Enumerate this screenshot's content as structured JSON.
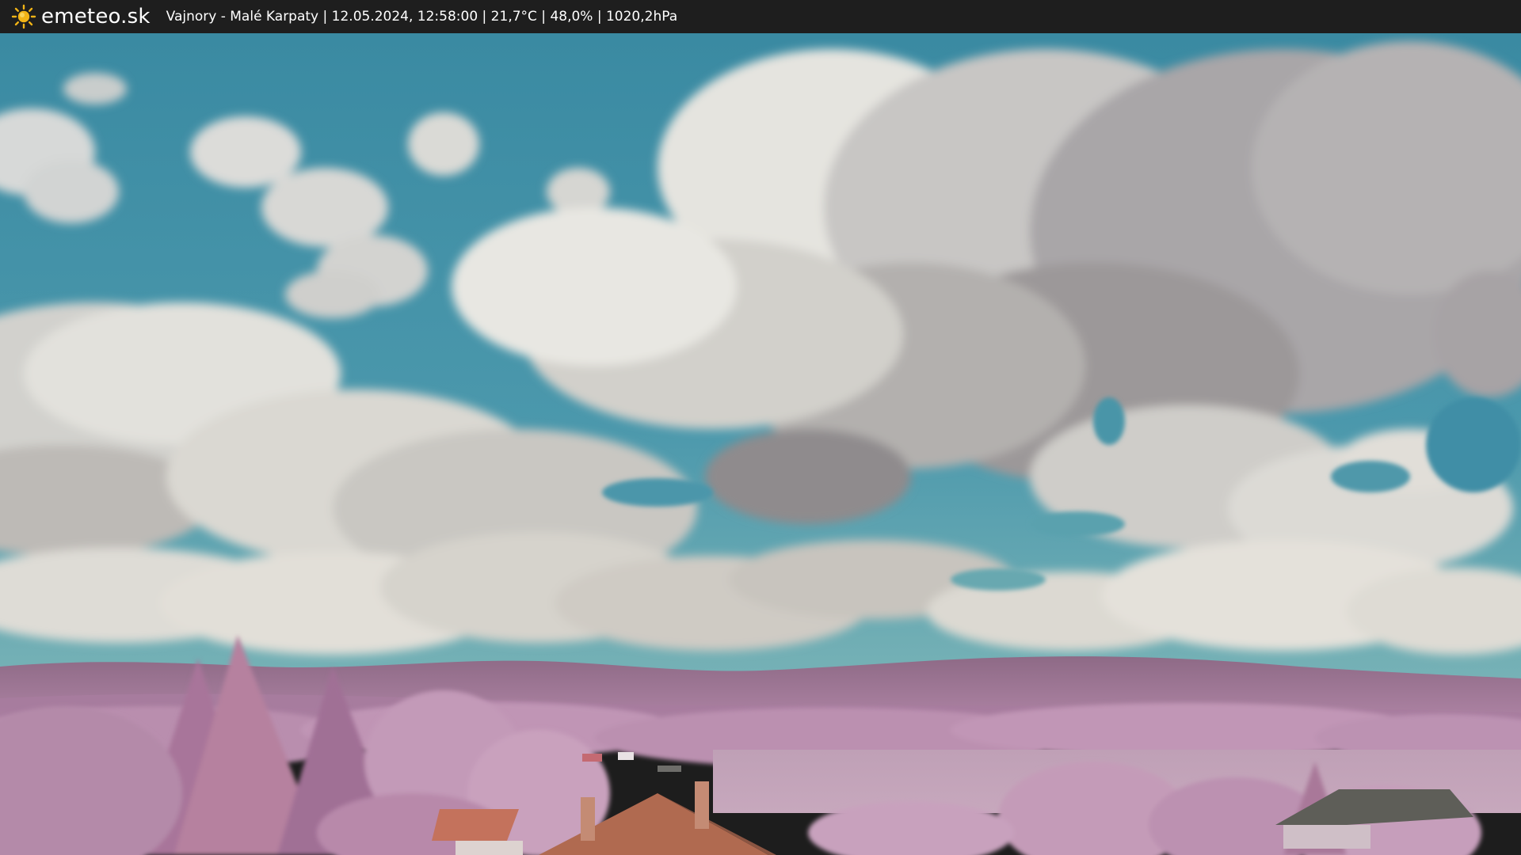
{
  "header": {
    "brand": "emeteo.sk",
    "caption": "Vajnory - Malé Karpaty | 12.05.2024, 12:58:00 | 21,7°C | 48,0% | 1020,2hPa",
    "brand_icon": "sun-icon"
  },
  "colors": {
    "topbar": "#1e1e1e",
    "sun": "#f2b416",
    "sky": "#3f8fa6",
    "foliage": "#c98fbc"
  }
}
